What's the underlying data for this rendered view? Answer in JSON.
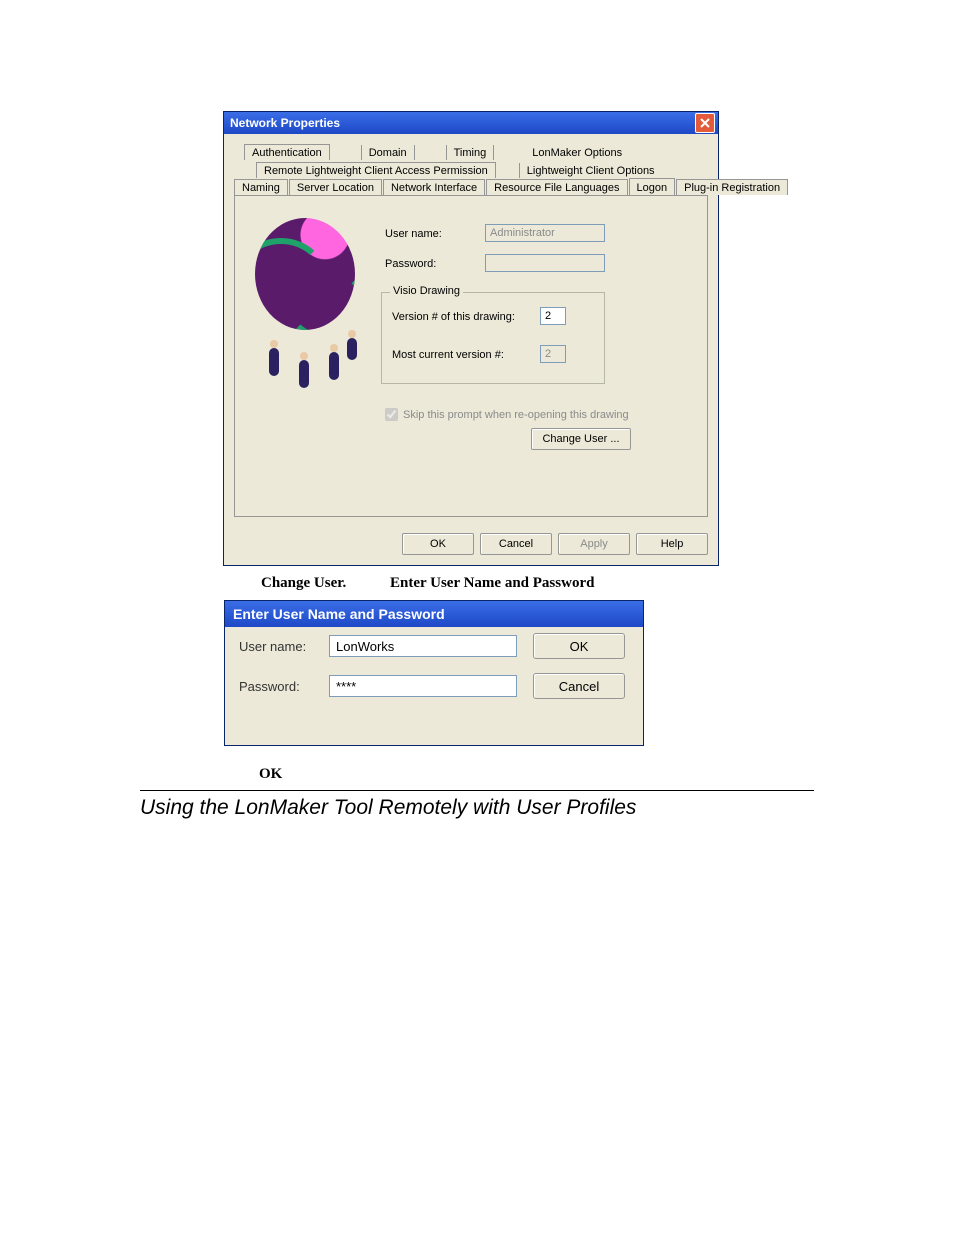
{
  "network_properties": {
    "title": "Network Properties",
    "tabs_row1": [
      "Authentication",
      "Domain",
      "Timing",
      "LonMaker Options"
    ],
    "tabs_row2": [
      "Remote Lightweight Client Access Permission",
      "Lightweight Client Options"
    ],
    "tabs_row3": [
      "Naming",
      "Server Location",
      "Network Interface",
      "Resource File Languages",
      "Logon",
      "Plug-in Registration"
    ],
    "selected_tab": "Logon",
    "username_label": "User name:",
    "username_value": "Administrator",
    "password_label": "Password:",
    "password_value": "",
    "visio_group": "Visio Drawing",
    "version_label": "Version # of this drawing:",
    "version_value": "2",
    "most_current_label": "Most current version #:",
    "most_current_value": "2",
    "skip_prompt_label": "Skip this prompt when re-opening this drawing",
    "skip_prompt_checked": true,
    "change_user_btn": "Change User ...",
    "ok_btn": "OK",
    "cancel_btn": "Cancel",
    "apply_btn": "Apply",
    "help_btn": "Help"
  },
  "caption1": "Change User.",
  "caption2": "Enter User Name and Password",
  "login_dialog": {
    "title": "Enter User Name and Password",
    "username_label": "User name:",
    "username_value": "LonWorks",
    "password_label": "Password:",
    "password_value": "****",
    "ok_btn": "OK",
    "cancel_btn": "Cancel"
  },
  "ok_text": "OK",
  "section_heading": "Using the LonMaker Tool Remotely with User Profiles"
}
